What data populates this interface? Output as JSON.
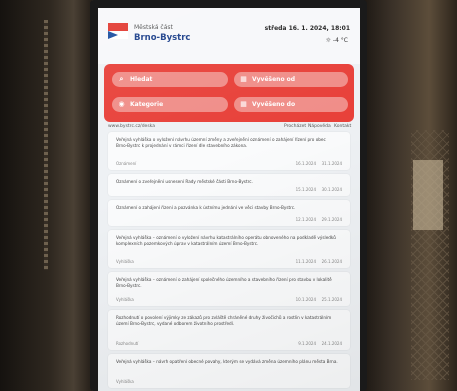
{
  "header": {
    "city_small": "Městská část",
    "city_name": "Brno-Bystrc",
    "datetime": "středa 16. 1. 2024, 18:01",
    "weather": "☼ -4 °C"
  },
  "nav": {
    "buttons": [
      {
        "label": "Hledat",
        "icon": "search-icon"
      },
      {
        "label": "Vyvěšeno od",
        "icon": "calendar-icon"
      },
      {
        "label": "Kategorie",
        "icon": "category-icon"
      },
      {
        "label": "Vyvěšeno do",
        "icon": "calendar-icon"
      }
    ]
  },
  "subbar": {
    "link": "www.bystrc.cz/deska",
    "items": [
      "Procházet",
      "Nápověda",
      "Kontakt"
    ]
  },
  "notices": [
    {
      "text": "Veřejná vyhláška o vyložení návrhu územní změny a zveřejnění oznámení o zahájení řízení pro obec Brno-Bystrc k projednání v rámci řízení dle stavebního zákona.",
      "meta": "Oznámení",
      "d1": "16.1.2024",
      "d2": "31.1.2024"
    },
    {
      "text": "Oznámení o zveřejnění usnesení Rady městské části Brno-Bystrc.",
      "meta": "Usnesení",
      "d1": "15.1.2024",
      "d2": "30.1.2024"
    },
    {
      "text": "Oznámení o zahájení řízení a pozvánka k ústnímu jednání ve věci stavby Brno-Bystrc.",
      "meta": "Oznámení",
      "d1": "12.1.2024",
      "d2": "29.1.2024"
    },
    {
      "text": "Veřejná vyhláška – oznámení o vyložení návrhu katastrálního operátu obnoveného na podkladě výsledků komplexních pozemkových úprav v katastrálním území Brno-Bystrc.",
      "meta": "Vyhláška",
      "d1": "11.1.2024",
      "d2": "26.1.2024"
    },
    {
      "text": "Veřejná vyhláška – oznámení o zahájení společného územního a stavebního řízení pro stavbu v lokalitě Brno-Bystrc.",
      "meta": "Vyhláška",
      "d1": "10.1.2024",
      "d2": "25.1.2024"
    },
    {
      "text": "Rozhodnutí o povolení výjimky ze zákazů pro zvláště chráněné druhy živočichů a rostlin v katastrálním území Brno-Bystrc, vydané odborem životního prostředí.",
      "meta": "Rozhodnutí",
      "d1": "9.1.2024",
      "d2": "24.1.2024"
    },
    {
      "text": "Veřejná vyhláška – návrh opatření obecné povahy, kterým se vydává změna územního plánu města Brna.",
      "meta": "Vyhláška",
      "d1": "8.1.2024",
      "d2": "23.1.2024"
    }
  ]
}
